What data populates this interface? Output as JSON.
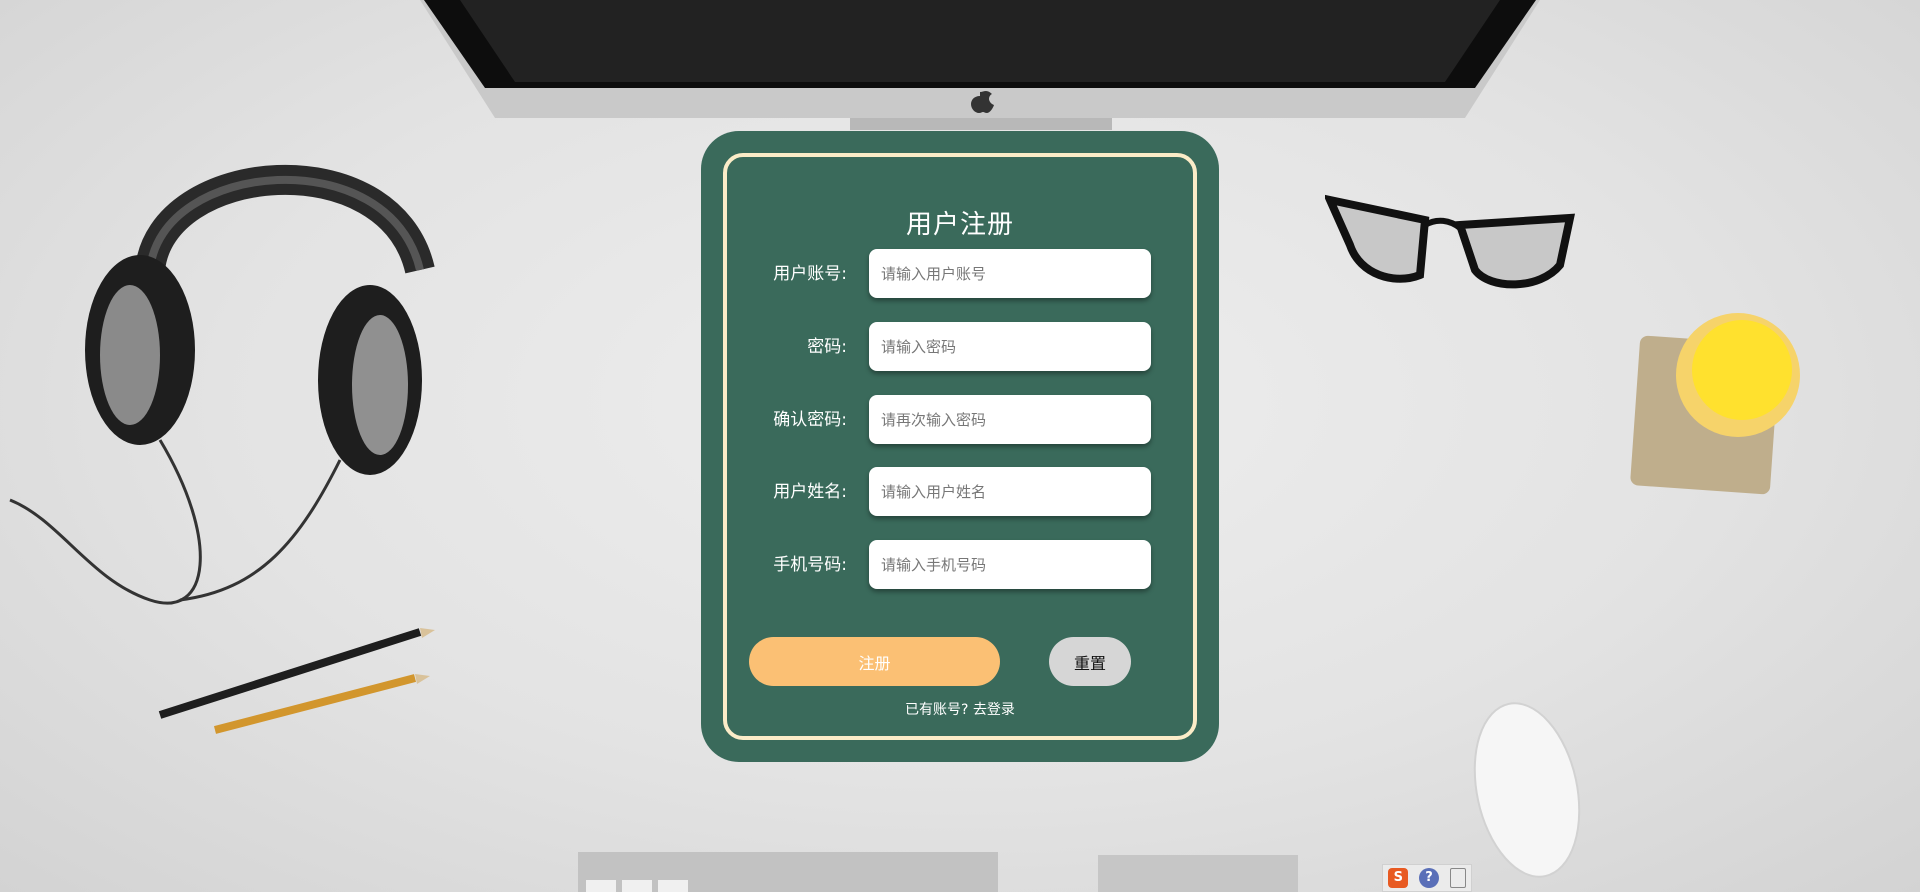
{
  "page": {
    "title": "用户注册"
  },
  "form": {
    "fields": [
      {
        "label": "用户账号:",
        "placeholder": "请输入用户账号",
        "value": ""
      },
      {
        "label": "密码:",
        "placeholder": "请输入密码",
        "value": ""
      },
      {
        "label": "确认密码:",
        "placeholder": "请再次输入密码",
        "value": ""
      },
      {
        "label": "用户姓名:",
        "placeholder": "请输入用户姓名",
        "value": ""
      },
      {
        "label": "手机号码:",
        "placeholder": "请输入手机号码",
        "value": ""
      }
    ],
    "register_label": "注册",
    "reset_label": "重置",
    "login_prompt": "已有账号?",
    "login_link": "去登录"
  },
  "tray": {
    "ime_glyph": "S",
    "help_glyph": "?"
  },
  "colors": {
    "card_bg": "#3a6a5b",
    "card_border": "#fbecc8",
    "register_button": "#fbc074",
    "reset_button": "#d6d6d6"
  },
  "icons": {
    "ime": "sogou-ime-icon",
    "help": "help-icon",
    "expand": "expand-icon"
  }
}
